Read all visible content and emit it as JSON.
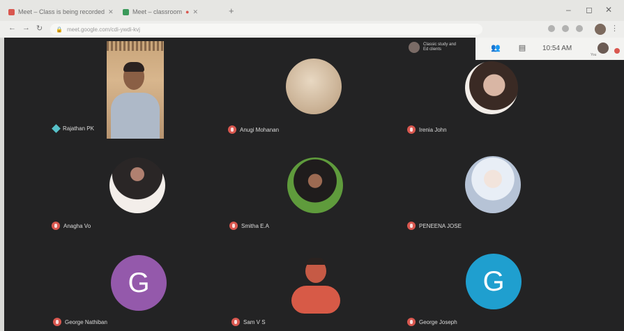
{
  "browser": {
    "tabs": [
      {
        "title": "Meet – Class is being recorded",
        "favicon_color": "#d9574f"
      },
      {
        "title": "Meet – classroom"
      }
    ],
    "url": "meet.google.com/cdi-ywdi-kvj",
    "window_controls": {
      "minimize": "–",
      "maximize": "◻",
      "close": "✕"
    }
  },
  "meeting": {
    "clock": "10:54 AM",
    "captions_text": "Classic study and Ed clients",
    "overlay_label": "You",
    "participants": [
      {
        "name": "Rajathan PK",
        "type": "video"
      },
      {
        "name": "Anugi Mohanan",
        "type": "photo",
        "color": "#c9b59a"
      },
      {
        "name": "Irenia John",
        "type": "photo",
        "color": "#8a6a58"
      },
      {
        "name": "Anagha Vo",
        "type": "photo",
        "color": "#b9a09a"
      },
      {
        "name": "Smitha E.A",
        "type": "photo",
        "color": "#5f9b3c"
      },
      {
        "name": "PENEENA JOSE",
        "type": "photo",
        "color": "#b6c3d6"
      },
      {
        "name": "George Nathiban",
        "type": "letter",
        "letter": "G",
        "color": "#9459ab"
      },
      {
        "name": "Sam V S",
        "type": "photo",
        "color": "#d75a47"
      },
      {
        "name": "George Joseph",
        "type": "letter",
        "letter": "G",
        "color": "#1f9fcf"
      }
    ]
  }
}
